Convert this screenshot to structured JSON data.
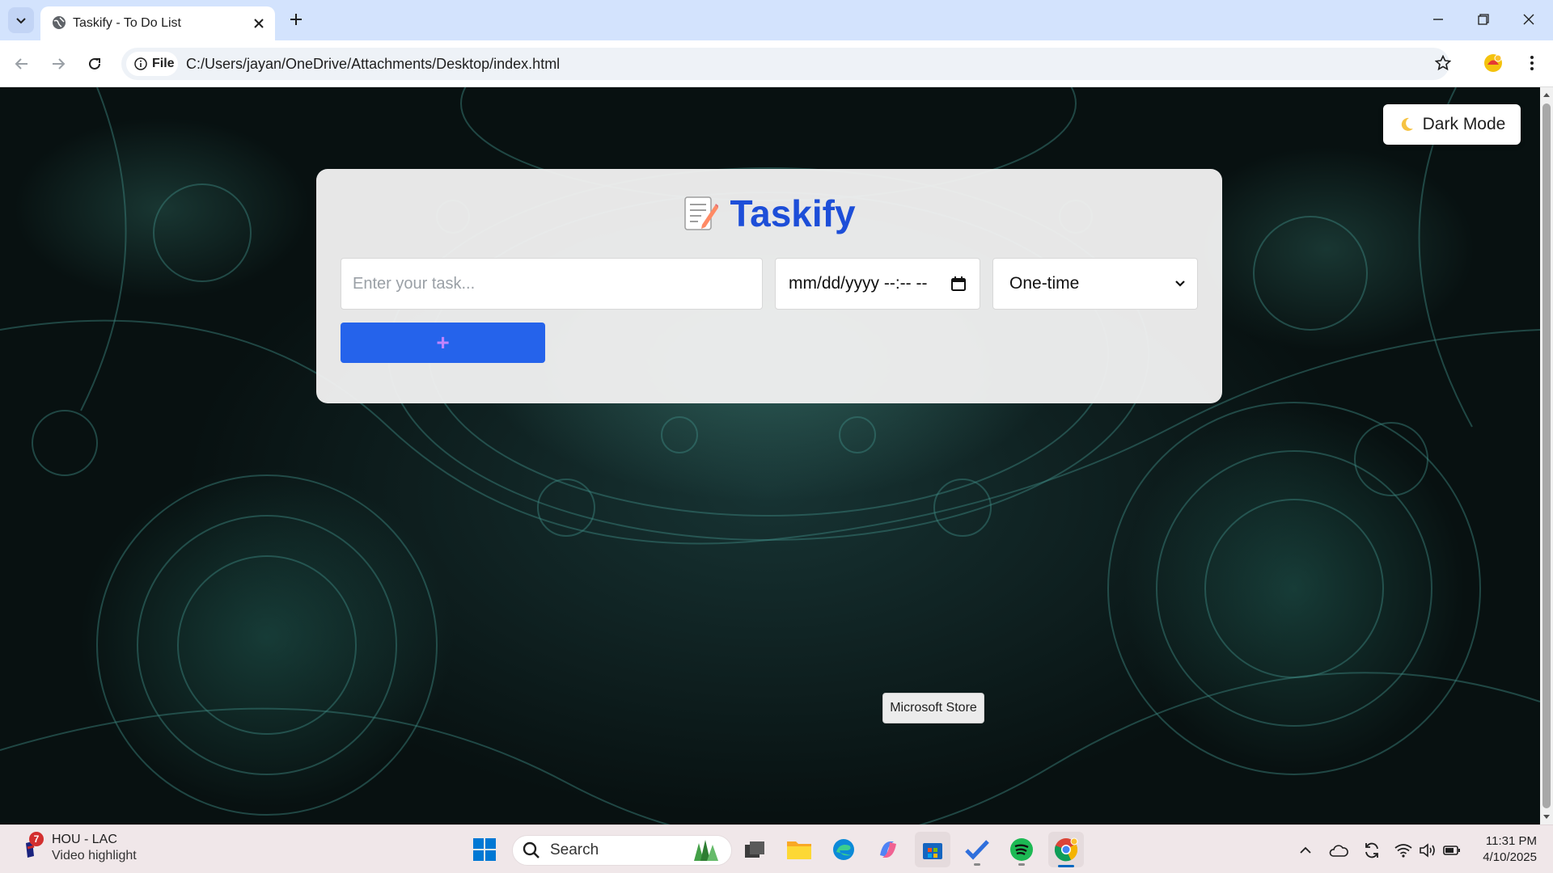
{
  "browser": {
    "tab_title": "Taskify - To Do List",
    "site_chip": "File",
    "url": "C:/Users/jayan/OneDrive/Attachments/Desktop/index.html"
  },
  "page": {
    "dark_mode_label": "Dark Mode",
    "app_title": "Taskify",
    "task_placeholder": "Enter your task...",
    "date_placeholder": "mm/dd/yyyy --:-- --",
    "frequency_selected": "One-time",
    "add_label": "+"
  },
  "tooltip": "Microsoft Store",
  "taskbar": {
    "widget_badge": "7",
    "widget_title": "HOU - LAC",
    "widget_subtitle": "Video highlight",
    "search_label": "Search",
    "time": "11:31 PM",
    "date": "4/10/2025"
  },
  "colors": {
    "tab_strip": "#d3e3fd",
    "accent_blue": "#2563eb",
    "title_blue": "#1d4ed8",
    "plus_color": "#c084fc"
  }
}
